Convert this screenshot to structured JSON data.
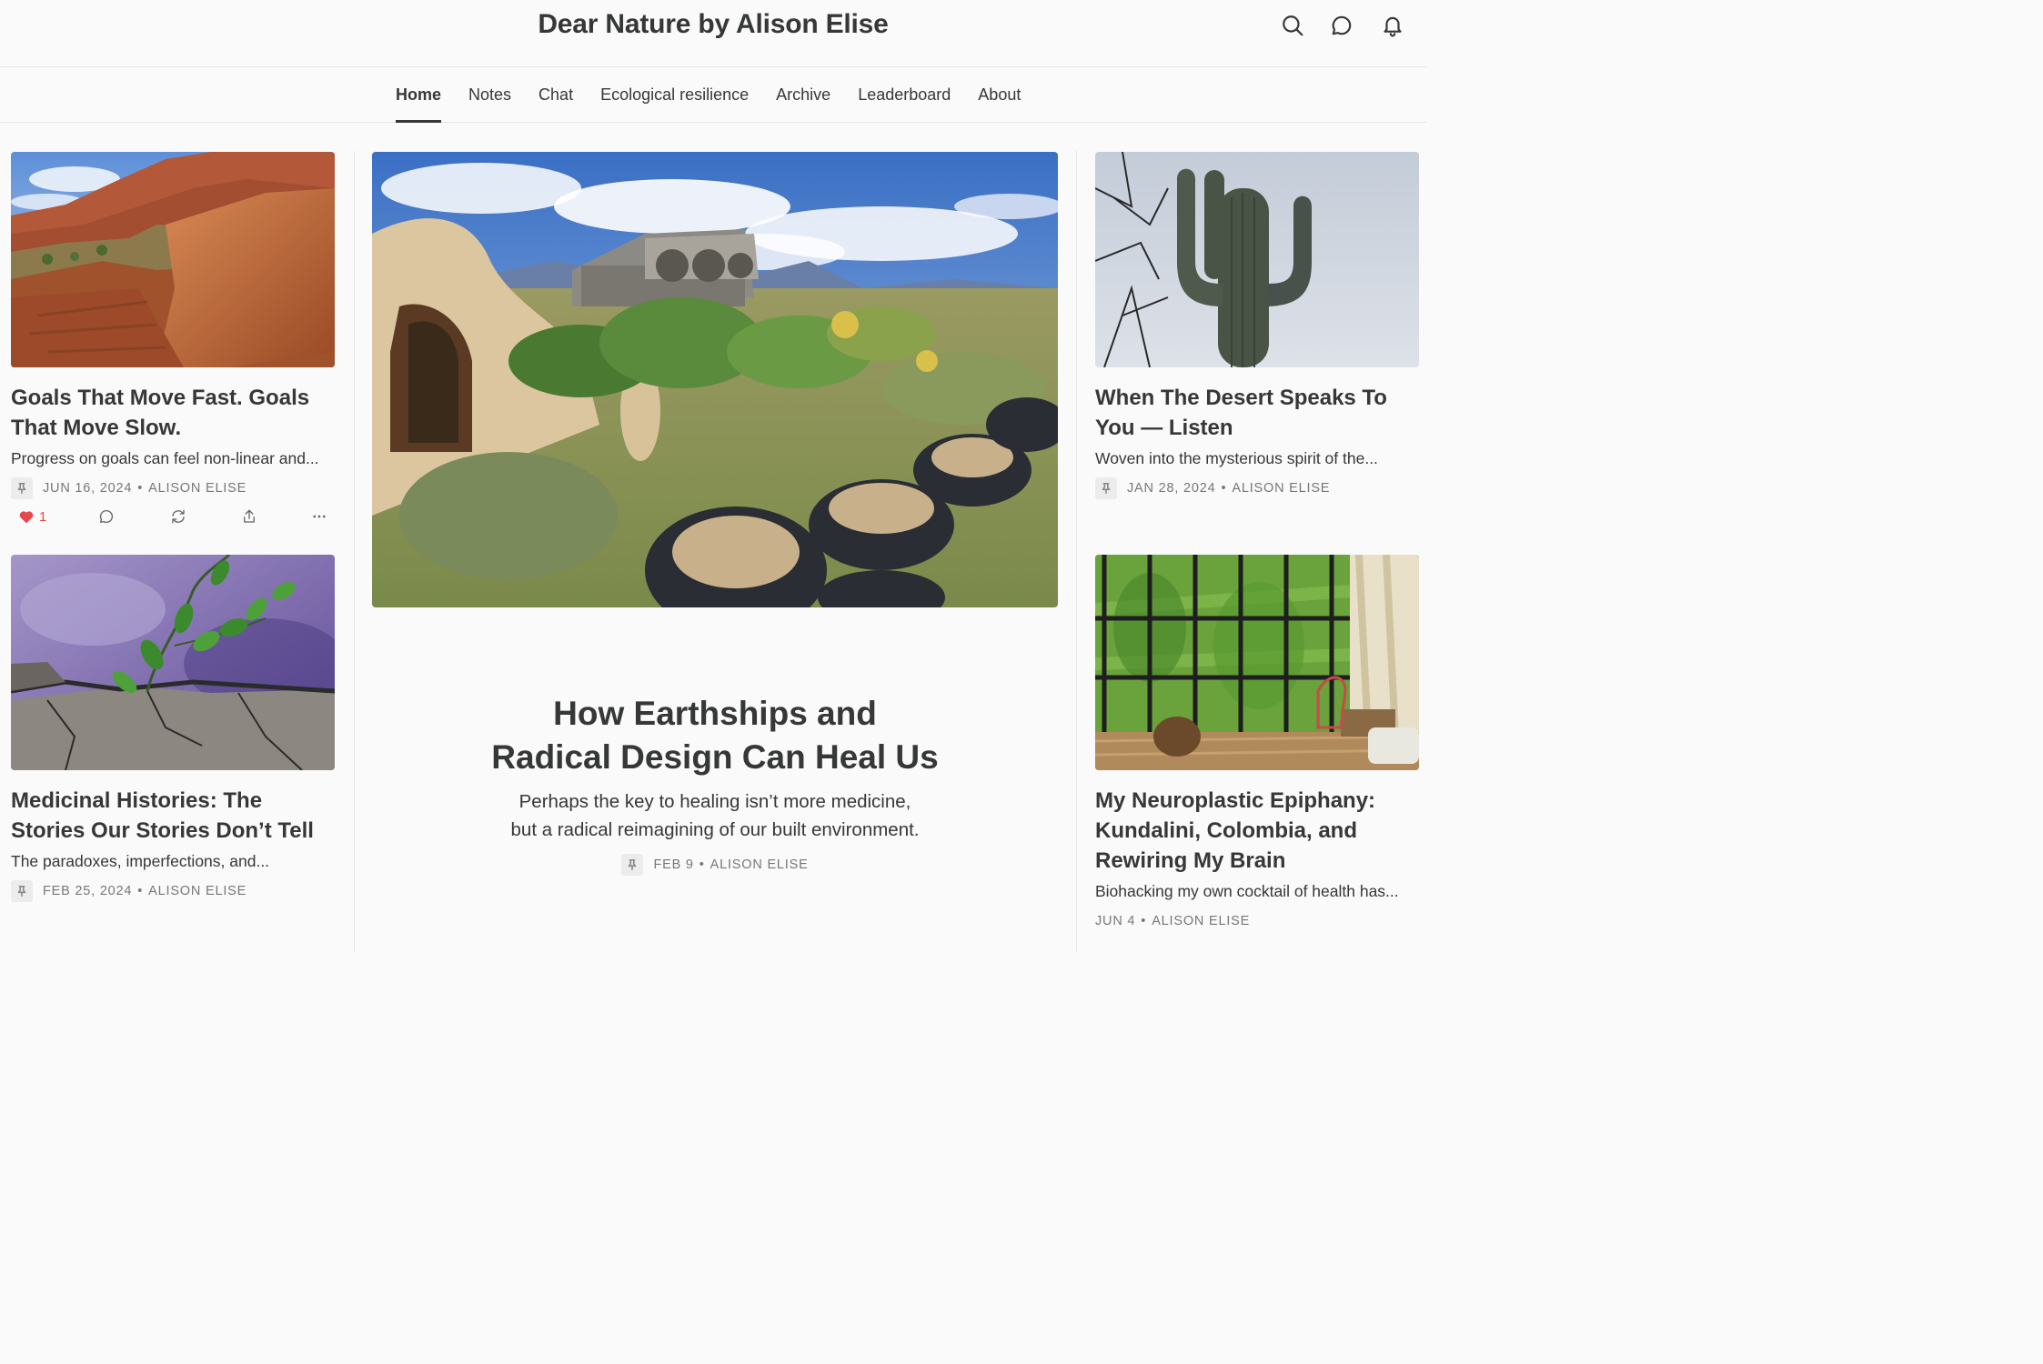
{
  "header": {
    "title": "Dear Nature by Alison Elise",
    "icons": [
      "search-icon",
      "chat-icon",
      "bell-icon"
    ]
  },
  "nav": {
    "items": [
      {
        "label": "Home",
        "active": true
      },
      {
        "label": "Notes"
      },
      {
        "label": "Chat"
      },
      {
        "label": "Ecological resilience"
      },
      {
        "label": "Archive"
      },
      {
        "label": "Leaderboard"
      },
      {
        "label": "About"
      }
    ]
  },
  "posts": {
    "left_top": {
      "title": "Goals That Move Fast. Goals That Move Slow.",
      "subtitle": "Progress on goals can feel non-linear and...",
      "date": "JUN 16, 2024",
      "author": "ALISON ELISE",
      "pinned": true,
      "likes": "1",
      "image": "red rock desert canyon"
    },
    "left_bottom": {
      "title": "Medicinal Histories: The Stories Our Stories Don’t Tell",
      "subtitle": "The paradoxes, imperfections, and...",
      "date": "FEB 25, 2024",
      "author": "ALISON ELISE",
      "pinned": true,
      "image": "watercolor painting of plant growing from cracked stone"
    },
    "hero": {
      "title_line1": "How Earthships and",
      "title_line2": "Radical Design Can Heal Us",
      "subtitle_line1": "Perhaps the key to healing isn’t more medicine,",
      "subtitle_line2": "but a radical reimagining of our built environment.",
      "date": "FEB 9",
      "author": "ALISON ELISE",
      "pinned": true,
      "image": "earthship buildings with tire planters in high desert"
    },
    "right_top": {
      "title": "When The Desert Speaks To You — Listen",
      "subtitle": "Woven into the mysterious spirit of the...",
      "date": "JAN 28, 2024",
      "author": "ALISON ELISE",
      "pinned": true,
      "image": "saguaro cactus against pale sky"
    },
    "right_bottom": {
      "title": "My Neuroplastic Epiphany: Kundalini, Colombia, and Rewiring My Brain",
      "subtitle": "Biohacking my own cocktail of health has...",
      "date": "JUN 4",
      "author": "ALISON ELISE",
      "pinned": false,
      "image": "room with black-framed windows facing cornfield"
    }
  },
  "colors": {
    "background": "#fafafa",
    "text": "#363737",
    "meta": "#777777",
    "like": "#e5484d",
    "divider": "#e6e6e6"
  }
}
